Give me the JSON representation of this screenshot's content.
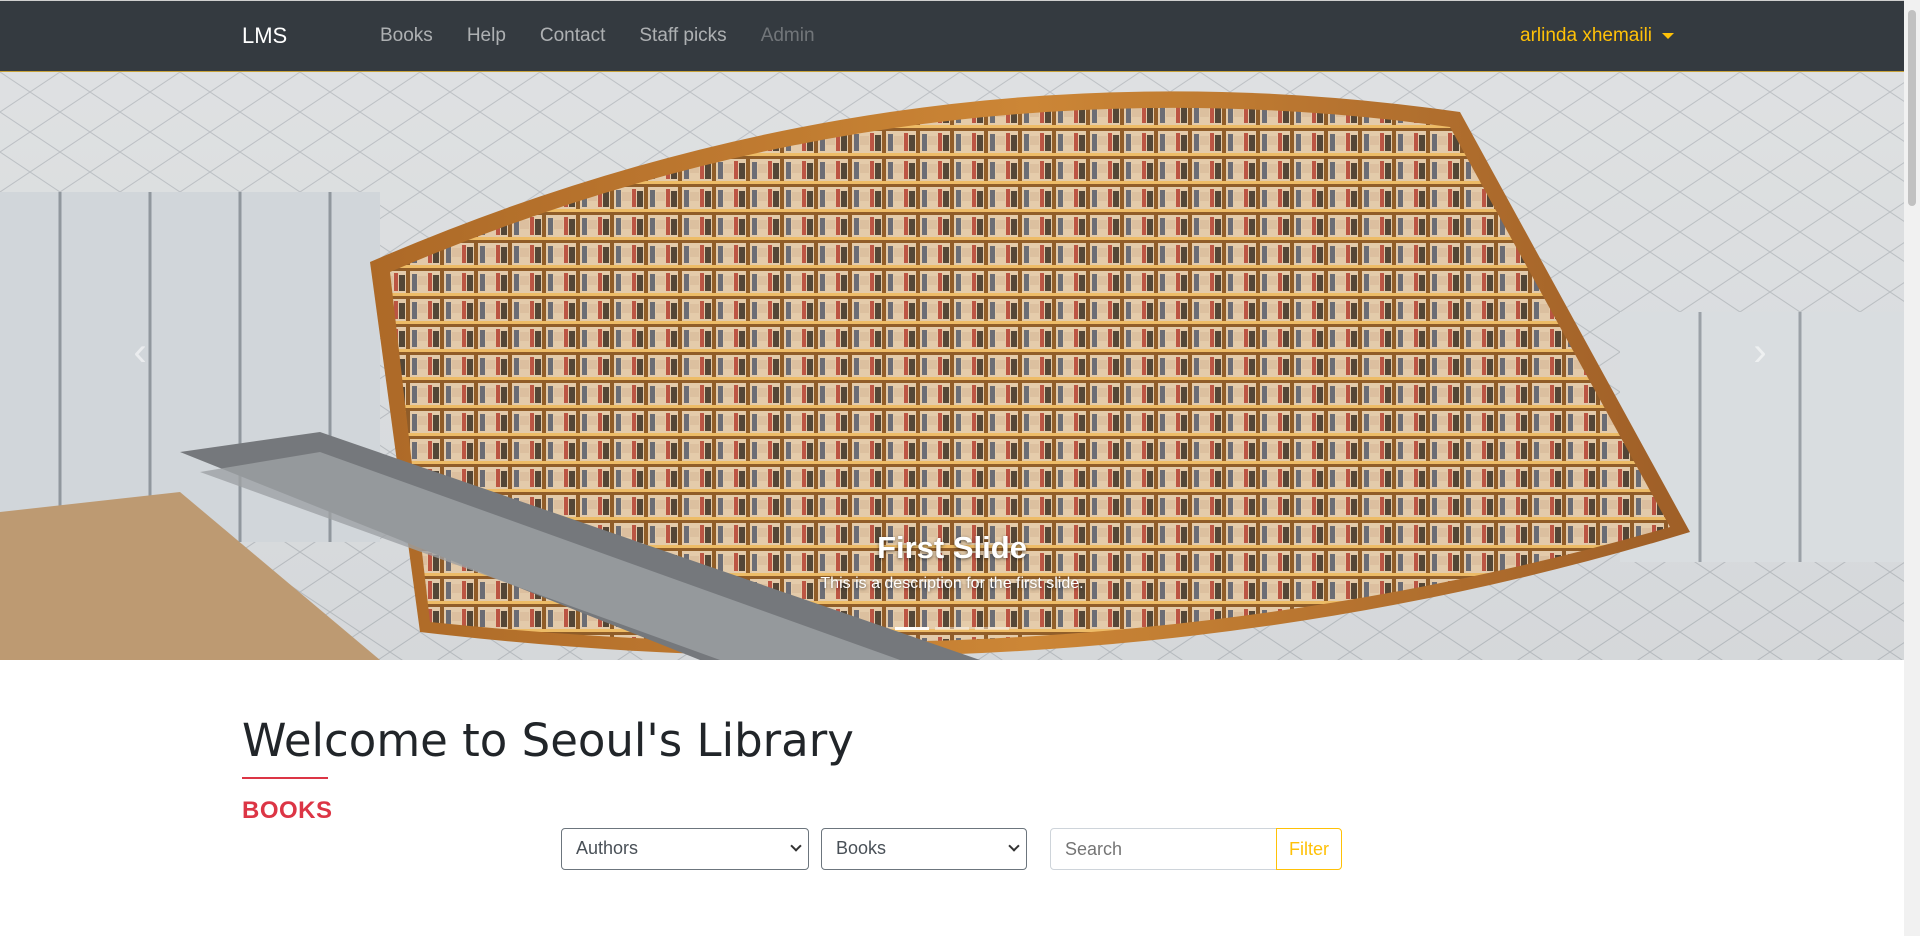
{
  "navbar": {
    "brand": "LMS",
    "links": [
      "Books",
      "Help",
      "Contact",
      "Staff picks"
    ],
    "admin_link": "Admin",
    "user_name": "arlinda xhemaili",
    "user_caret_icon": "caret-down-icon"
  },
  "carousel": {
    "slide_title": "First Slide",
    "slide_description": "This is a description for the first slide.",
    "indicator_count": 3,
    "active_indicator": 1,
    "prev_icon": "chevron-left-icon",
    "next_icon": "chevron-right-icon"
  },
  "main": {
    "title": "Welcome to Seoul's Library",
    "section_heading": "BOOKS",
    "authors_select": "Authors",
    "books_select": "Books",
    "search_placeholder": "Search",
    "filter_label": "Filter"
  },
  "colors": {
    "navbar_bg": "#343a40",
    "accent_yellow": "#ffc107",
    "accent_red": "#dc3545"
  }
}
